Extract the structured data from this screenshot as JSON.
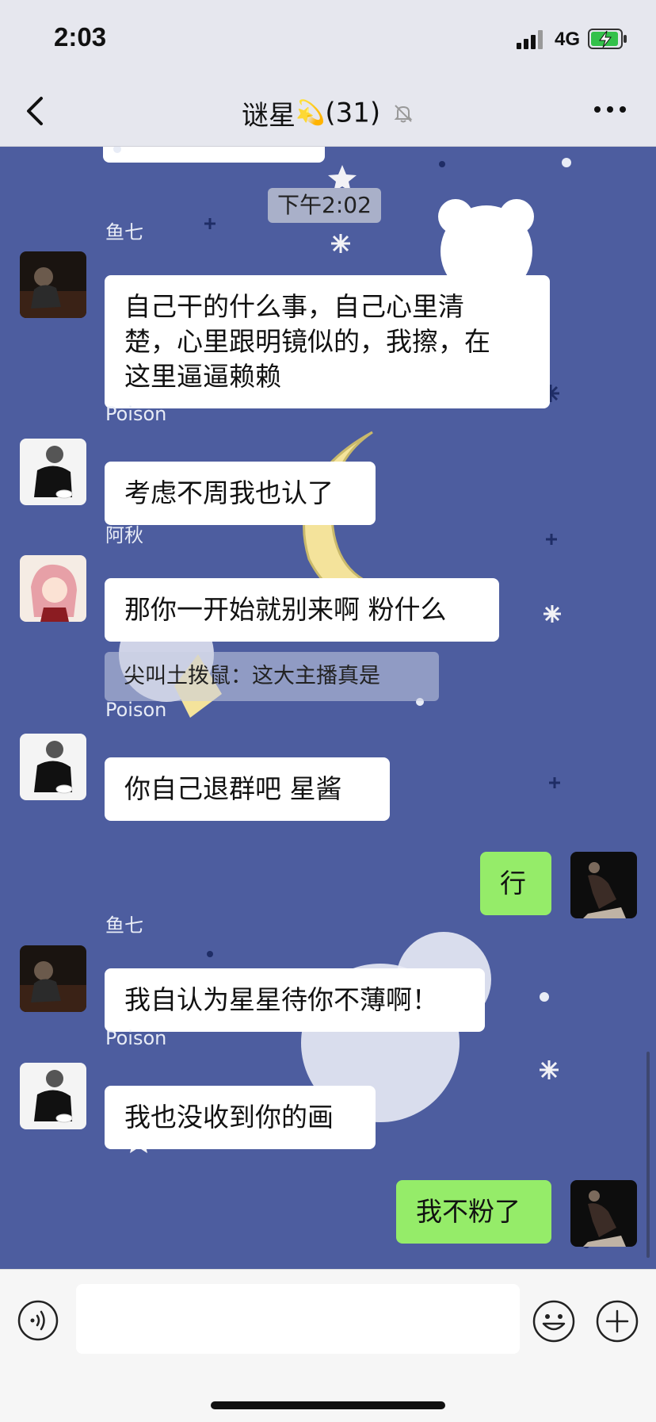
{
  "status_bar": {
    "time": "2:03",
    "network": "4G"
  },
  "header": {
    "title": "谜星",
    "sparkle": "💫",
    "member_count": "(31)"
  },
  "chat": {
    "timestamp": "下午2:02",
    "messages": [
      {
        "sender": "鱼七",
        "text_lines": [
          "自己干的什么事，自己心里清",
          "楚，心里跟明镜似的，我擦，在",
          "这里逼逼赖赖"
        ]
      },
      {
        "sender": "Poison",
        "text": "考虑不周我也认了"
      },
      {
        "sender": "阿秋",
        "text": "那你一开始就别来啊 粉什么",
        "quote": "尖叫土拨鼠：这大主播真是"
      },
      {
        "sender": "Poison",
        "text": "你自己退群吧 星酱"
      },
      {
        "sender": "",
        "text": "行",
        "self": true
      },
      {
        "sender": "鱼七",
        "text": "我自认为星星待你不薄啊！"
      },
      {
        "sender": "Poison",
        "text": "我也没收到你的画"
      },
      {
        "sender": "",
        "text": "我不粉了",
        "self": true
      }
    ]
  },
  "input": {
    "placeholder": ""
  },
  "colors": {
    "chat_bg": "#4d5d9f",
    "self_bubble": "#95ec69",
    "other_bubble": "#ffffff"
  }
}
